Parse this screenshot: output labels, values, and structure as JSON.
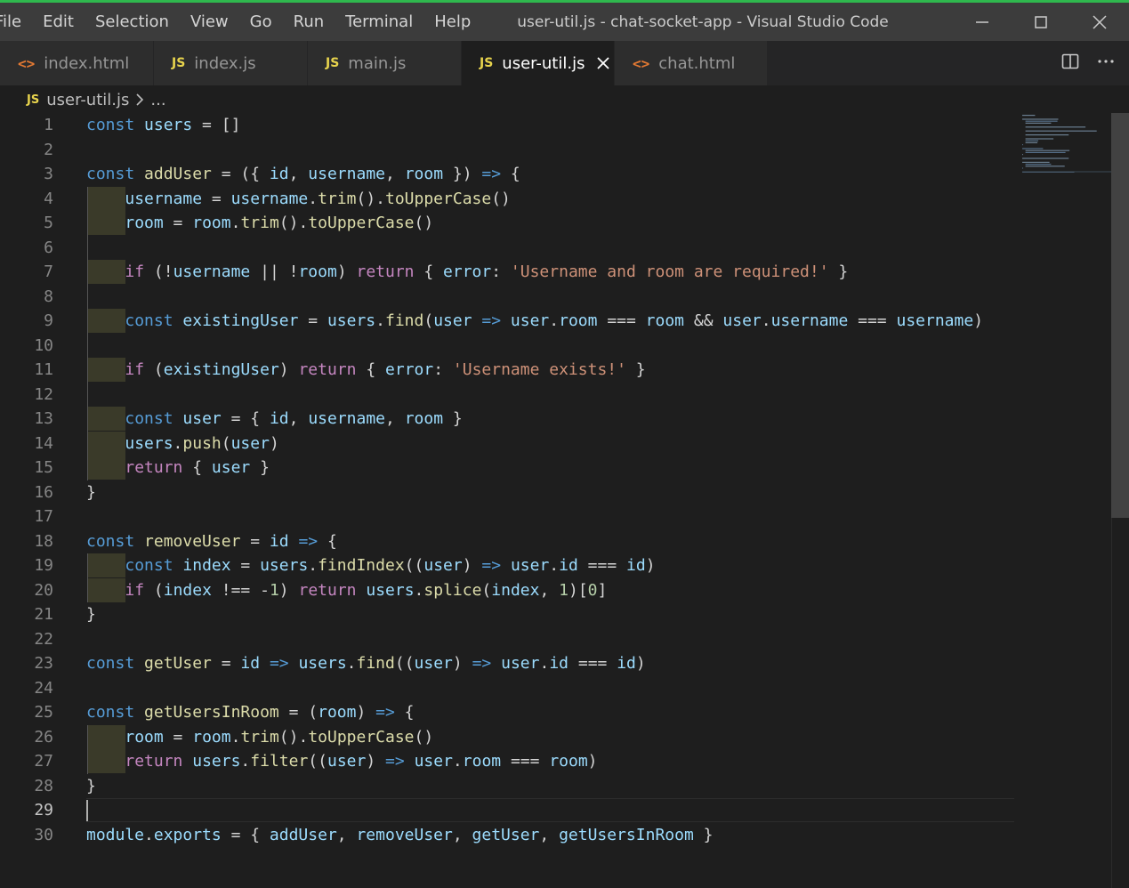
{
  "menu": [
    "File",
    "Edit",
    "Selection",
    "View",
    "Go",
    "Run",
    "Terminal",
    "Help"
  ],
  "window_title": "user-util.js - chat-socket-app - Visual Studio Code",
  "tabs": [
    {
      "label": "index.html",
      "icon": "<>",
      "kind": "html"
    },
    {
      "label": "index.js",
      "icon": "JS",
      "kind": "js"
    },
    {
      "label": "main.js",
      "icon": "JS",
      "kind": "js"
    },
    {
      "label": "user-util.js",
      "icon": "JS",
      "kind": "js",
      "active": true
    },
    {
      "label": "chat.html",
      "icon": "<>",
      "kind": "html"
    }
  ],
  "breadcrumb": {
    "icon": "JS",
    "file": "user-util.js",
    "rest": "..."
  },
  "cursor_line": 29,
  "line_numbers": [
    "1",
    "2",
    "3",
    "4",
    "5",
    "6",
    "7",
    "8",
    "9",
    "10",
    "11",
    "12",
    "13",
    "14",
    "15",
    "16",
    "17",
    "18",
    "19",
    "20",
    "21",
    "22",
    "23",
    "24",
    "25",
    "26",
    "27",
    "28",
    "29",
    "30"
  ],
  "code_lines": [
    "const users = []",
    "",
    "const addUser = ({ id, username, room }) => {",
    "    username = username.trim().toUpperCase()",
    "    room = room.trim().toUpperCase()",
    "",
    "    if (!username || !room) return { error: 'Username and room are required!' }",
    "",
    "    const existingUser = users.find(user => user.room === room && user.username === username)",
    "",
    "    if (existingUser) return { error: 'Username exists!' }",
    "",
    "    const user = { id, username, room }",
    "    users.push(user)",
    "    return { user }",
    "}",
    "",
    "const removeUser = id => {",
    "    const index = users.findIndex((user) => user.id === id)",
    "    if (index !== -1) return users.splice(index, 1)[0]",
    "}",
    "",
    "const getUser = id => users.find((user) => user.id === id)",
    "",
    "const getUsersInRoom = (room) => {",
    "    room = room.trim().toUpperCase()",
    "    return users.filter((user) => user.room === room)",
    "}",
    "",
    "module.exports = { addUser, removeUser, getUser, getUsersInRoom }"
  ],
  "colors": {
    "keyword": "#569cd6",
    "function": "#dcdcaa",
    "variable": "#9cdcfe",
    "constant": "#4fc1ff",
    "control": "#c586c0",
    "string": "#ce9178",
    "number": "#b5cea8",
    "editor_bg": "#1e1e1e"
  }
}
